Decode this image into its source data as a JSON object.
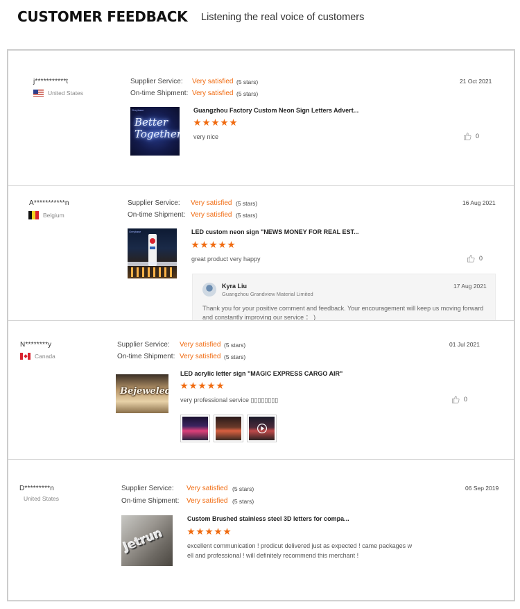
{
  "header": {
    "title": "CUSTOMER FEEDBACK",
    "subtitle": "Listening the real voice of  customers"
  },
  "colors": {
    "accent": "#f06a0f",
    "border": "#d5d5d5"
  },
  "reviews": [
    {
      "user": "j***********t",
      "country": "United States",
      "supplier_label": "Supplier Service:",
      "supplier_value": "Very satisfied",
      "supplier_stars": "(5 stars)",
      "shipment_label": "On-time Shipment:",
      "shipment_value": "Very satisfied",
      "shipment_stars": "(5 stars)",
      "date": "21 Oct 2021",
      "product_title": "Guangzhou Factory Custom Neon Sign Letters Advert...",
      "rating": 5,
      "comment": "very nice",
      "likes": "0",
      "thumb_text": "Better Together",
      "thumb_tag": "Greybase"
    },
    {
      "user": "A***********n",
      "country": "Belgium",
      "supplier_label": "Supplier Service:",
      "supplier_value": "Very satisfied",
      "supplier_stars": "(5 stars)",
      "shipment_label": "On-time Shipment:",
      "shipment_value": "Very satisfied",
      "shipment_stars": "(5 stars)",
      "date": "16 Aug 2021",
      "product_title": "LED custom neon sign \"NEWS MONEY FOR REAL EST...",
      "rating": 5,
      "comment": "great product very happy",
      "likes": "0",
      "thumb_tag": "Greybase",
      "reply": {
        "name": "Kyra Liu",
        "company": "Guangzhou Grandview Material Limited",
        "date": "17 Aug 2021",
        "text": "Thank you for your positive comment and feedback. Your encouragement will keep us moving forward and constantly improving our service  ： )"
      }
    },
    {
      "user": "N********y",
      "country": "Canada",
      "supplier_label": "Supplier Service:",
      "supplier_value": "Very satisfied",
      "supplier_stars": "(5 stars)",
      "shipment_label": "On-time Shipment:",
      "shipment_value": "Very satisfied",
      "shipment_stars": "(5 stars)",
      "date": "01 Jul 2021",
      "product_title": "LED acrylic letter sign \"MAGIC EXPRESS CARGO AIR\"",
      "rating": 5,
      "comment": "very professional service ▯▯▯▯▯▯▯▯",
      "likes": "0",
      "thumb_text": "Bejeweled"
    },
    {
      "user": "D*********n",
      "country": "United States",
      "supplier_label": "Supplier Service:",
      "supplier_value": "Very satisfied",
      "supplier_stars": "(5 stars)",
      "shipment_label": "On-time Shipment:",
      "shipment_value": "Very satisfied",
      "shipment_stars": "(5 stars)",
      "date": "06 Sep 2019",
      "product_title": "Custom Brushed stainless steel 3D letters for compa...",
      "rating": 5,
      "comment_line1": "excellent communication ! prodicut delivered just as expected ! came packages w",
      "comment_line2": "ell and professional ! will definitely recommend this merchant !",
      "thumb_text": "Jetrun"
    }
  ]
}
